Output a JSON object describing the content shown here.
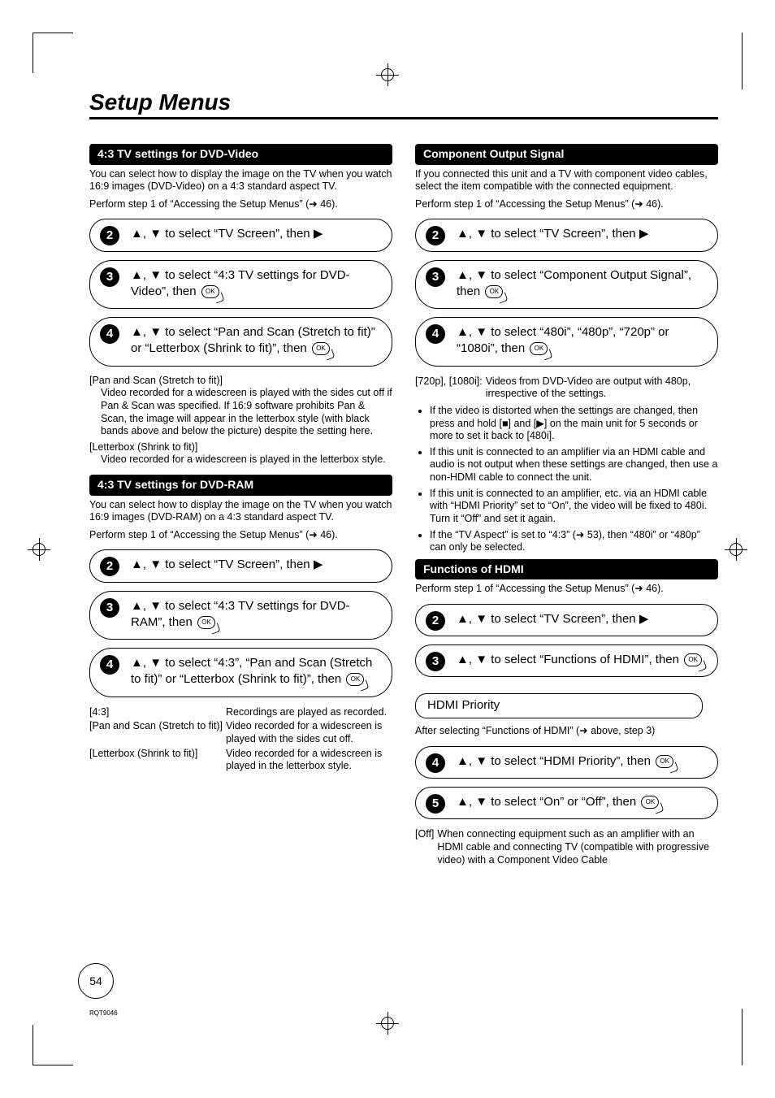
{
  "page": {
    "title": "Setup Menus",
    "number": "54",
    "footer_code": "RQT9046"
  },
  "icons": {
    "ok": "OK"
  },
  "left": {
    "sec1": {
      "header": "4:3 TV settings for DVD-Video",
      "intro": "You can select how to display the image on the TV when you watch 16:9 images (DVD-Video) on a 4:3 standard aspect TV.",
      "perform": "Perform step 1 of “Accessing the Setup Menus” (➜ 46).",
      "step2": " to select “TV Screen”, then ",
      "step3a": " to select “4:3 TV settings for DVD-Video”, then ",
      "step4a": " to select “Pan and Scan (Stretch to fit)” or “Letterbox (Shrink to fit)”, then ",
      "def1_term": "[Pan and Scan (Stretch to fit)]",
      "def1_desc": "Video recorded for a widescreen is played with the sides cut off if Pan & Scan was specified. If 16:9 software prohibits Pan & Scan, the image will appear in the letterbox style (with black bands above and below the picture) despite the setting here.",
      "def2_term": "[Letterbox (Shrink to fit)]",
      "def2_desc": "Video recorded for a widescreen is played in the letterbox style."
    },
    "sec2": {
      "header": "4:3 TV settings for DVD-RAM",
      "intro": "You can select how to display the image on the TV when you watch 16:9 images (DVD-RAM) on a 4:3 standard aspect TV.",
      "perform": "Perform step 1 of “Accessing the Setup Menus” (➜ 46).",
      "step2": " to select “TV Screen”, then ",
      "step3a": " to select “4:3 TV settings for DVD-RAM”, then ",
      "step4a": " to select “4:3”, “Pan and Scan (Stretch to fit)” or “Letterbox (Shrink to fit)”, then ",
      "tab": {
        "r1c1": "[4:3]",
        "r1c2": "Recordings are played as recorded.",
        "r2c1": "[Pan and Scan (Stretch to fit)]",
        "r2c2": "Video recorded for a widescreen is played with the sides cut off.",
        "r3c1": "[Letterbox (Shrink to fit)]",
        "r3c2": "Video recorded for a widescreen is played in the letterbox style."
      }
    }
  },
  "right": {
    "sec1": {
      "header": "Component Output Signal",
      "intro": "If you connected this unit and a TV with component video cables, select the item compatible with the connected equipment.",
      "perform": "Perform step 1 of “Accessing the Setup Menus” (➜ 46).",
      "step2": " to select “TV Screen”, then ",
      "step3a": " to select “Component Output Signal”, then ",
      "step4a": " to select “480i”, “480p”, “720p” or “1080i”, then ",
      "note_head": "[720p], [1080i]:",
      "note_body": "Videos from DVD-Video are output with 480p, irrespective of the settings.",
      "b1a": "If the video is distorted when the settings are changed, then press and hold [",
      "b1b": "] and [",
      "b1c": "] on the main unit for 5 seconds or more to set it back to [480i].",
      "b2": "If this unit is connected to an amplifier via an HDMI cable and audio is not output when these settings are changed, then use a non-HDMI cable to connect the unit.",
      "b3": "If this unit is connected to an amplifier, etc. via an HDMI cable with “HDMI Priority” set to “On”, the video will be fixed to 480i. Turn it “Off” and set it again.",
      "b4": "If the “TV Aspect” is set to “4:3” (➜ 53), then “480i” or “480p” can only be selected."
    },
    "sec2": {
      "header": "Functions of HDMI",
      "perform": "Perform step 1 of “Accessing the Setup Menus” (➜ 46).",
      "step2": " to select “TV Screen”, then ",
      "step3a": " to select “Functions of HDMI”, then ",
      "sub": "HDMI Priority",
      "after": "After selecting “Functions of HDMI” (➜ above, step 3)",
      "step4a": " to select “HDMI Priority”, then ",
      "step5a": " to select “On” or “Off”, then ",
      "off_term": "[Off]",
      "off_desc": "When connecting equipment such as an amplifier with an HDMI cable and connecting TV (compatible with progressive video) with a Component Video Cable"
    }
  }
}
